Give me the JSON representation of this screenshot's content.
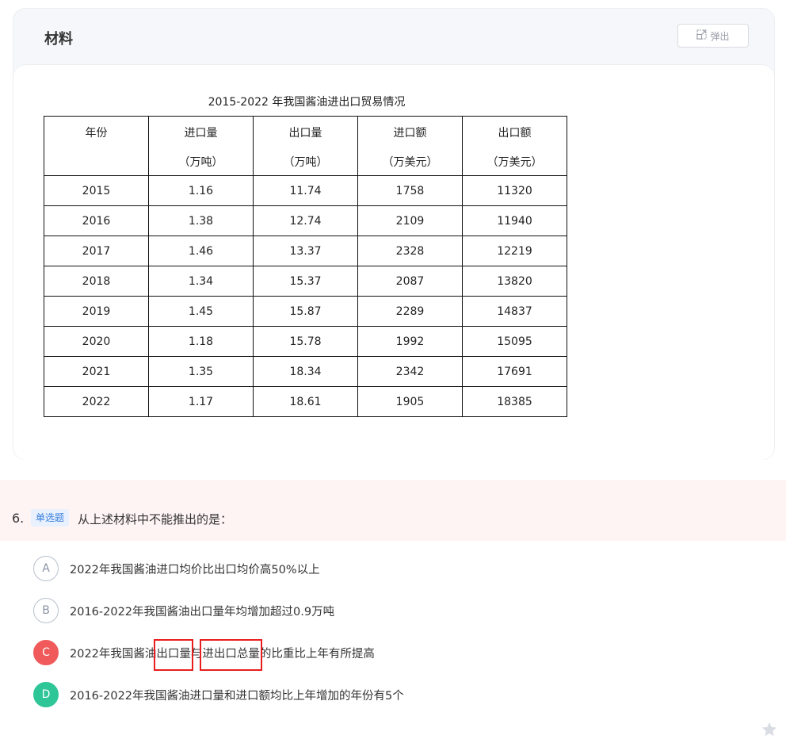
{
  "material": {
    "title": "材料",
    "popout_label": "弹出",
    "table_caption": "2015-2022 年我国酱油进出口贸易情况",
    "columns": [
      {
        "l1": "年份",
        "l2": ""
      },
      {
        "l1": "进口量",
        "l2": "（万吨）"
      },
      {
        "l1": "出口量",
        "l2": "（万吨）"
      },
      {
        "l1": "进口额",
        "l2": "（万美元）"
      },
      {
        "l1": "出口额",
        "l2": "（万美元）"
      }
    ],
    "rows": [
      [
        "2015",
        "1.16",
        "11.74",
        "1758",
        "11320"
      ],
      [
        "2016",
        "1.38",
        "12.74",
        "2109",
        "11940"
      ],
      [
        "2017",
        "1.46",
        "13.37",
        "2328",
        "12219"
      ],
      [
        "2018",
        "1.34",
        "15.37",
        "2087",
        "13820"
      ],
      [
        "2019",
        "1.45",
        "15.87",
        "2289",
        "14837"
      ],
      [
        "2020",
        "1.18",
        "15.78",
        "1992",
        "15095"
      ],
      [
        "2021",
        "1.35",
        "18.34",
        "2342",
        "17691"
      ],
      [
        "2022",
        "1.17",
        "18.61",
        "1905",
        "18385"
      ]
    ]
  },
  "question": {
    "number": "6.",
    "type": "单选题",
    "text": "从上述材料中不能推出的是："
  },
  "options": {
    "a": {
      "letter": "A",
      "text": "2022年我国酱油进口均价比出口均价高50%以上"
    },
    "b": {
      "letter": "B",
      "text": "2016-2022年我国酱油出口量年均增加超过0.9万吨"
    },
    "c": {
      "letter": "C",
      "pre": "2022年我国酱油",
      "hl1": "出口量",
      "mid": "与",
      "hl2": "进出口总量",
      "post": "的比重比上年有所提高"
    },
    "d": {
      "letter": "D",
      "text": "2016-2022年我国酱油进口量和进口额均比上年增加的年份有5个"
    }
  },
  "colors": {
    "wrong": "#f05a5a",
    "correct": "#2ec597",
    "highlight_box": "#e81e1e"
  },
  "icons": {
    "popout": "popout-icon",
    "favorite": "star-icon"
  }
}
